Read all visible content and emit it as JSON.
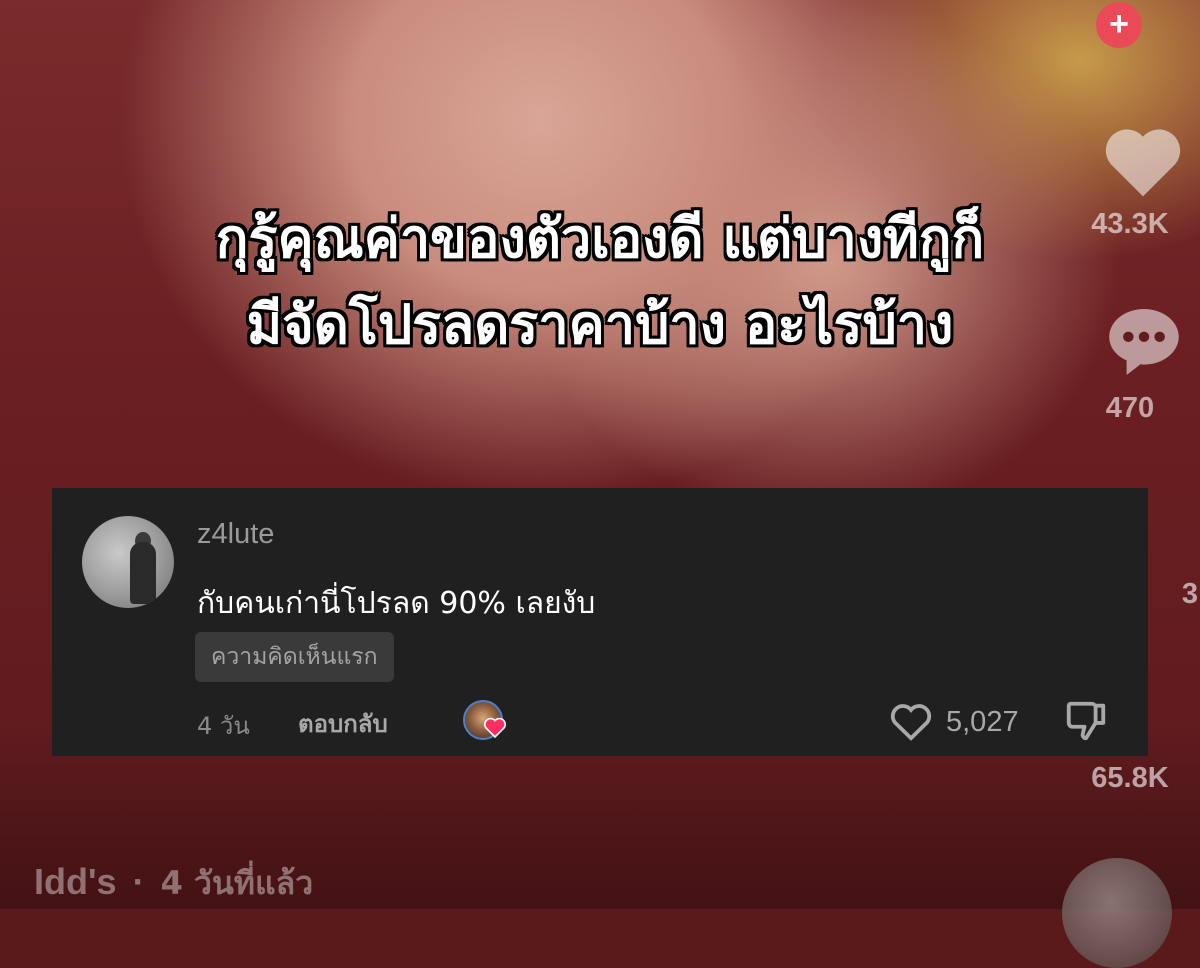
{
  "caption": {
    "line1": "กุรู้คุณค่าของตัวเองดี แต่บางทีกูก็",
    "line2": "มีจัดโปรลดราคาบ้าง อะไรบ้าง"
  },
  "rail": {
    "follow_icon": "plus-icon",
    "like_count": "43.3K",
    "comment_count": "470",
    "share_count": "65.8K",
    "partial_count": "3"
  },
  "comment": {
    "username": "z4lute",
    "text": "กับคนเก่านี่โปรลด 90% เลยงับ",
    "badge": "ความคิดเห็นแรก",
    "time": "4 วัน",
    "reply_label": "ตอบกลับ",
    "like_count": "5,027",
    "creator_liked": true
  },
  "footer": {
    "account": "Idd's",
    "separator": "·",
    "posted": "4 วันที่แล้ว"
  },
  "colors": {
    "card_bg": "#202020",
    "badge_bg": "#3a3a3a",
    "accent_red": "#ea4a58",
    "heart_pink": "#ff2f63"
  }
}
